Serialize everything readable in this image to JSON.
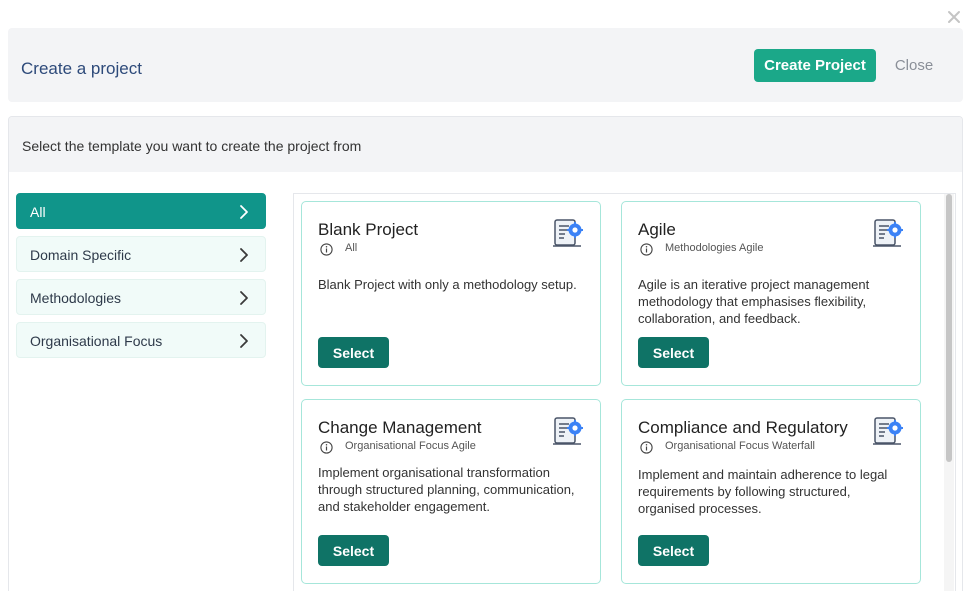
{
  "window": {
    "close_icon": "close-icon"
  },
  "header": {
    "title": "Create a project",
    "create_label": "Create Project",
    "close_label": "Close"
  },
  "subheader": {
    "text": "Select the template you want to create the project from"
  },
  "categories": [
    {
      "label": "All",
      "active": true
    },
    {
      "label": "Domain Specific",
      "active": false
    },
    {
      "label": "Methodologies",
      "active": false
    },
    {
      "label": "Organisational Focus",
      "active": false
    }
  ],
  "cards": [
    {
      "title": "Blank Project",
      "tags": "All",
      "description": "Blank Project with only a methodology setup.",
      "select_label": "Select"
    },
    {
      "title": "Agile",
      "tags": "Methodologies Agile",
      "description": "Agile is an iterative project management methodology that emphasises flexibility, collaboration, and feedback.",
      "select_label": "Select"
    },
    {
      "title": "Change Management",
      "tags": "Organisational Focus Agile",
      "description": "Implement organisational transformation through structured planning, communication, and stakeholder engagement.",
      "select_label": "Select"
    },
    {
      "title": "Compliance and Regulatory",
      "tags": "Organisational Focus Waterfall",
      "description": "Implement and maintain adherence to legal requirements by following structured, organised processes.",
      "select_label": "Select"
    }
  ],
  "colors": {
    "primary": "#1ba889",
    "select_button": "#0f7366",
    "active_category": "#10958a",
    "card_border": "#a6e6da",
    "title_blue": "#2d4a7a"
  },
  "icons": {
    "template": "document-gear-icon",
    "info": "info-icon",
    "chevron": "chevron-right-icon"
  }
}
